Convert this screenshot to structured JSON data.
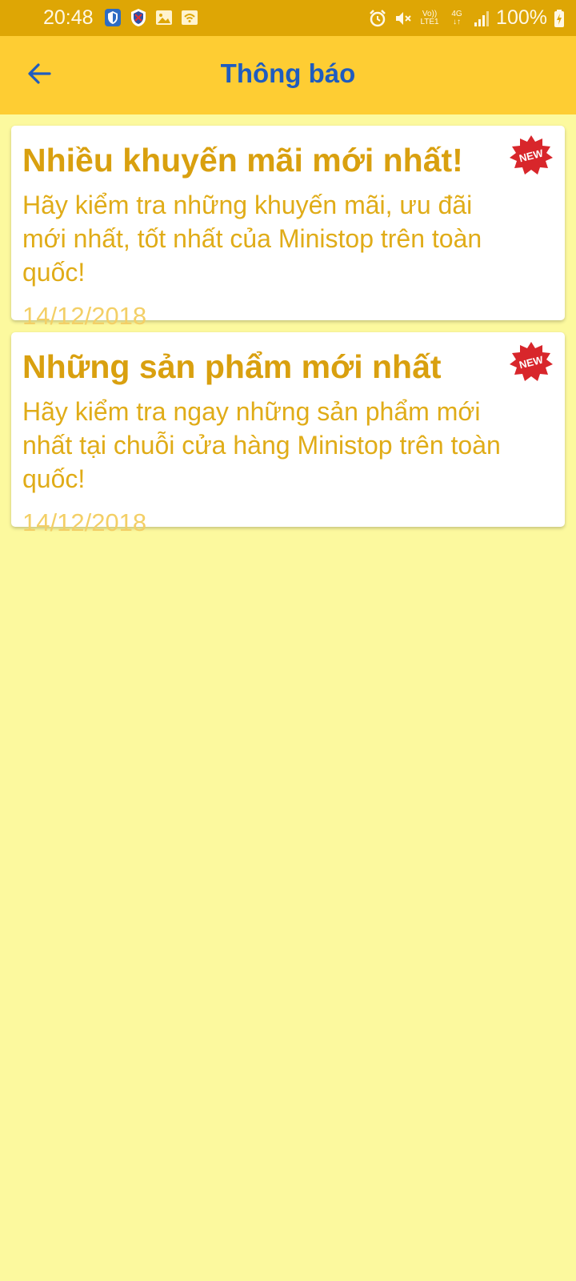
{
  "status_bar": {
    "time": "20:48",
    "network_top": "Vo))",
    "network_bottom": "LTE1",
    "data_top": "4G",
    "data_bottom": "↓↑",
    "battery_percent": "100%",
    "left_icons": [
      "shield-check-icon",
      "shield-alert-icon",
      "image-icon",
      "wifi-icon"
    ],
    "right_icons": [
      "alarm-icon",
      "mute-icon",
      "volte-icon",
      "4g-icon",
      "signal-icon",
      "battery-charging-icon"
    ]
  },
  "app_bar": {
    "title": "Thông báo",
    "back_icon": "arrow-left-icon"
  },
  "notifications": [
    {
      "title": "Nhiều khuyến mãi mới nhất!",
      "body": "Hãy kiểm tra những khuyến mãi, ưu đãi mới nhất, tốt nhất của Ministop trên toàn quốc!",
      "date": "14/12/2018",
      "badge": "NEW"
    },
    {
      "title": "Những sản phẩm mới nhất",
      "body": "Hãy kiểm tra ngay những sản phẩm mới nhất tại chuỗi cửa hàng Ministop trên toàn quốc!",
      "date": "14/12/2018",
      "badge": "NEW"
    }
  ],
  "colors": {
    "status_bar_bg": "#dea605",
    "app_bar_bg": "#fecd33",
    "title_color": "#1f5cbf",
    "page_bg": "#fcf99e",
    "card_title": "#d9a00f",
    "card_body": "#e0ac18",
    "card_date": "#f3cf66",
    "badge_red": "#d8262b"
  }
}
